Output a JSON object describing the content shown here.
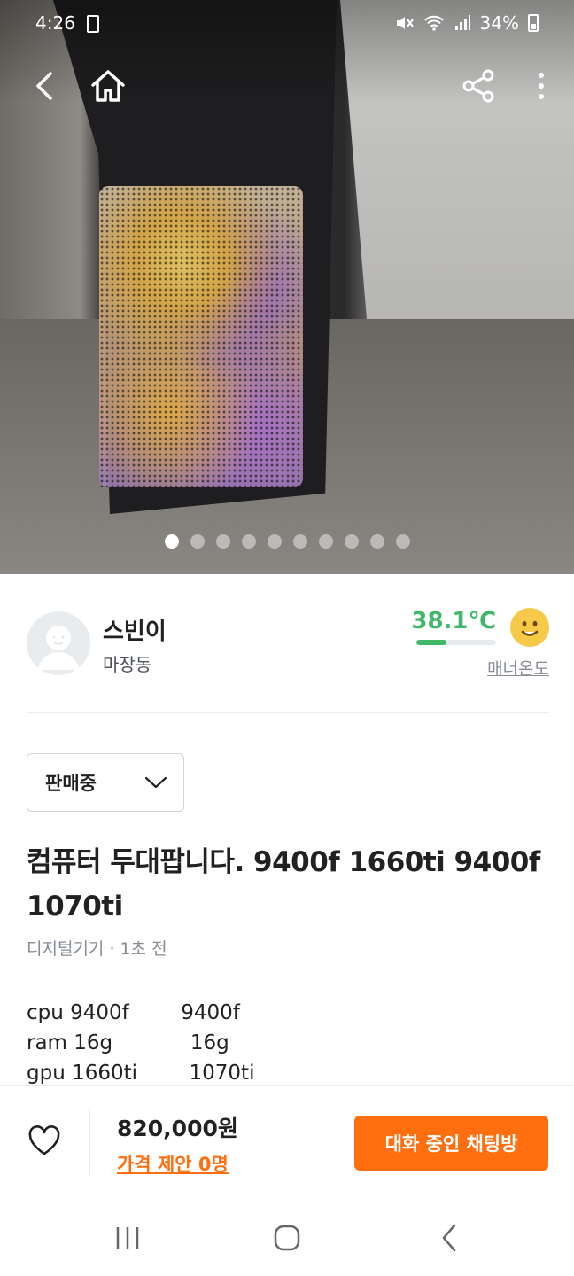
{
  "status_bar": {
    "time": "4:26",
    "battery": "34%"
  },
  "image": {
    "pager_total": 10,
    "pager_active": 1
  },
  "seller": {
    "name": "스빈이",
    "location": "마장동",
    "temperature": "38.1℃",
    "temperature_fraction": 0.381,
    "manner_label": "매너온도"
  },
  "sale_status": {
    "selected": "판매중"
  },
  "post": {
    "title": "컴퓨터 두대팝니다. 9400f 1660ti 9400f 1070ti",
    "meta": "디지털기기 · 1초 전",
    "description": "cpu 9400f        9400f\nram 16g            16g\ngpu 1660ti        1070ti"
  },
  "bottom_bar": {
    "price": "820,000원",
    "offer": "가격 제안 0명",
    "chat_button": "대화 중인 채팅방"
  },
  "colors": {
    "brand_orange": "#ff6f0f",
    "temp_green": "#3fb968",
    "text_primary": "#212124",
    "text_secondary": "#868b94"
  }
}
